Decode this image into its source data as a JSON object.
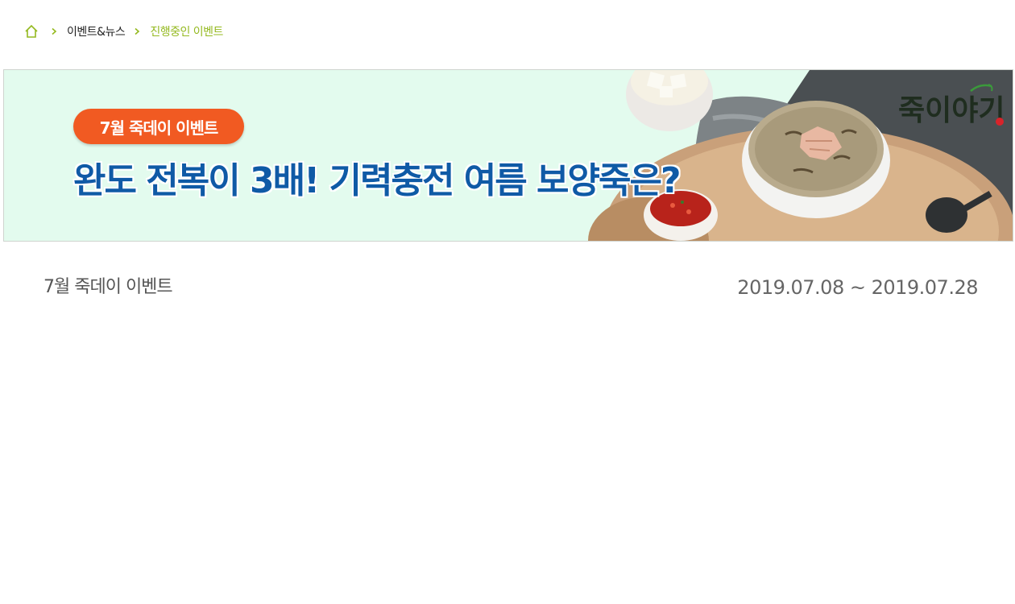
{
  "breadcrumb": {
    "home_icon": "home-icon",
    "separator_icon": "chevron-right-icon",
    "items": [
      {
        "label": "이벤트&뉴스"
      },
      {
        "label": "진행중인 이벤트"
      }
    ],
    "colors": {
      "accent": "#94b91f",
      "text": "#222222"
    }
  },
  "banner": {
    "badge_text": "7월 죽데이 이벤트",
    "headline": "완도 전복이 3배! 기력충전 여름 보양죽은?",
    "brand_logo_text": "죽이야기",
    "colors": {
      "background": "#e3fbee",
      "badge": "#f15a22",
      "headline": "#0f5aa6",
      "logo": "#1f2d1f"
    }
  },
  "event": {
    "title": "7월 죽데이 이벤트",
    "period": "2019.07.08 ~ 2019.07.28"
  }
}
